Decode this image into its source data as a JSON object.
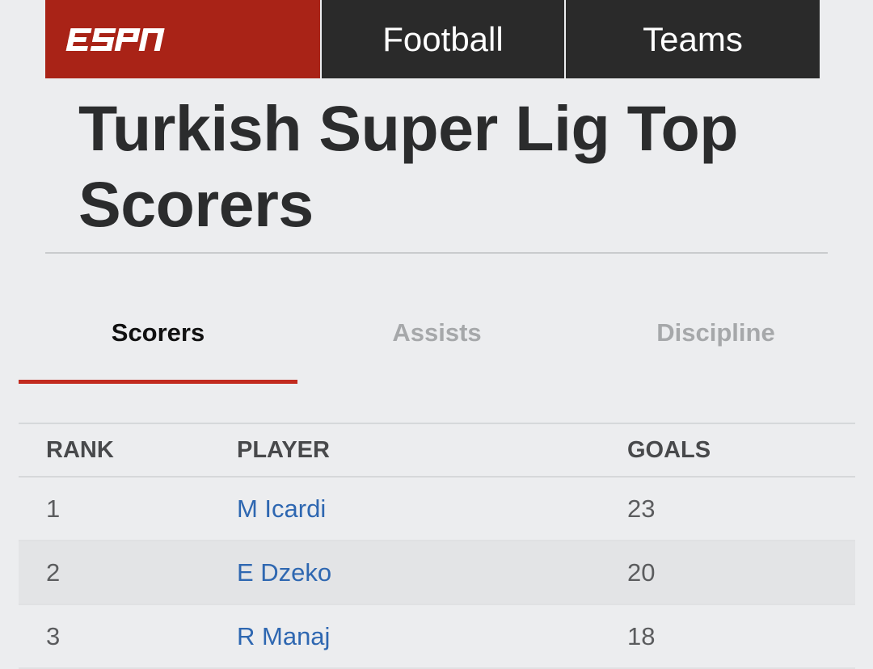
{
  "nav": {
    "logo_text": "ESPN",
    "items": [
      {
        "label": "Football"
      },
      {
        "label": "Teams"
      }
    ]
  },
  "page_title": "Turkish Super Lig Top Scorers",
  "tabs": [
    {
      "label": "Scorers",
      "active": true
    },
    {
      "label": "Assists",
      "active": false
    },
    {
      "label": "Discipline",
      "active": false
    }
  ],
  "table": {
    "headers": {
      "rank": "RANK",
      "player": "PLAYER",
      "goals": "GOALS"
    },
    "rows": [
      {
        "rank": "1",
        "player": "M Icardi",
        "goals": "23"
      },
      {
        "rank": "2",
        "player": "E Dzeko",
        "goals": "20"
      },
      {
        "rank": "3",
        "player": "R Manaj",
        "goals": "18"
      }
    ]
  },
  "colors": {
    "brand_red": "#a92317",
    "nav_dark": "#2a2a2a",
    "link_blue": "#2e67b1",
    "tab_indicator": "#c22b1f",
    "background": "#ecedef"
  }
}
